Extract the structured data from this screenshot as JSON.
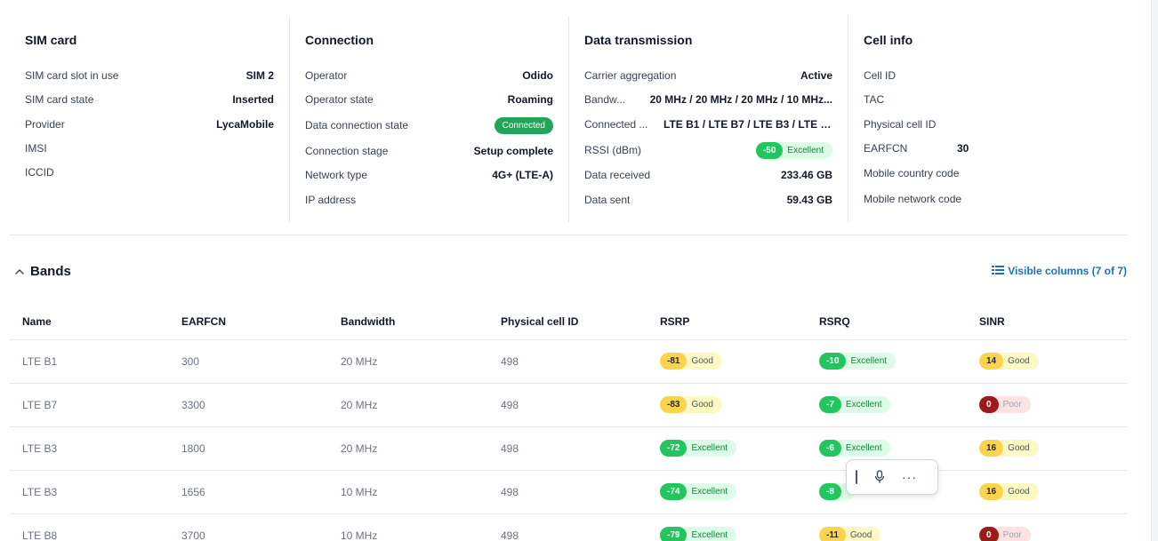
{
  "cards": {
    "sim": {
      "title": "SIM card",
      "rows": [
        {
          "k": "SIM card slot in use",
          "v": "SIM 2"
        },
        {
          "k": "SIM card state",
          "v": "Inserted"
        },
        {
          "k": "Provider",
          "v": "LycaMobile"
        },
        {
          "k": "IMSI",
          "v": ""
        },
        {
          "k": "ICCID",
          "v": ""
        }
      ]
    },
    "connection": {
      "title": "Connection",
      "rows": [
        {
          "k": "Operator",
          "v": "Odido"
        },
        {
          "k": "Operator state",
          "v": "Roaming"
        },
        {
          "k": "Data connection state",
          "v": "Connected"
        },
        {
          "k": "Connection stage",
          "v": "Setup complete"
        },
        {
          "k": "Network type",
          "v": "4G+ (LTE-A)"
        },
        {
          "k": "IP address",
          "v": ""
        }
      ]
    },
    "data": {
      "title": "Data transmission",
      "rows": [
        {
          "k": "Carrier aggregation",
          "v": "Active"
        },
        {
          "k": "Bandw...",
          "v": "20 MHz / 20 MHz / 20 MHz / 10 MHz..."
        },
        {
          "k": "Connected ...",
          "v": "LTE B1 / LTE B7 / LTE B3 / LTE B..."
        },
        {
          "k": "RSSI (dBm)",
          "v": "-50",
          "label": "Excellent"
        },
        {
          "k": "Data received",
          "v": "233.46 GB"
        },
        {
          "k": "Data sent",
          "v": "59.43 GB"
        }
      ]
    },
    "cell": {
      "title": "Cell info",
      "rows": [
        {
          "k": "Cell ID",
          "v": ""
        },
        {
          "k": "TAC",
          "v": ""
        },
        {
          "k": "Physical cell ID",
          "v": ""
        },
        {
          "k": "EARFCN",
          "v": "30"
        },
        {
          "k": "Mobile country code",
          "v": ""
        },
        {
          "k": "Mobile network code",
          "v": ""
        }
      ]
    }
  },
  "bands": {
    "title": "Bands",
    "visible_columns": "Visible columns (7 of 7)",
    "columns": [
      "Name",
      "EARFCN",
      "Bandwidth",
      "Physical cell ID",
      "RSRP",
      "RSRQ",
      "SINR"
    ],
    "rows": [
      {
        "name": "LTE B1",
        "earfcn": "300",
        "bw": "20 MHz",
        "pci": "498",
        "rsrp": {
          "v": "-81",
          "l": "Good",
          "c": "good"
        },
        "rsrq": {
          "v": "-10",
          "l": "Excellent",
          "c": "ex"
        },
        "sinr": {
          "v": "14",
          "l": "Good",
          "c": "good"
        }
      },
      {
        "name": "LTE B7",
        "earfcn": "3300",
        "bw": "20 MHz",
        "pci": "498",
        "rsrp": {
          "v": "-83",
          "l": "Good",
          "c": "good"
        },
        "rsrq": {
          "v": "-7",
          "l": "Excellent",
          "c": "ex"
        },
        "sinr": {
          "v": "0",
          "l": "Poor",
          "c": "poor"
        }
      },
      {
        "name": "LTE B3",
        "earfcn": "1800",
        "bw": "20 MHz",
        "pci": "498",
        "rsrp": {
          "v": "-72",
          "l": "Excellent",
          "c": "ex"
        },
        "rsrq": {
          "v": "-6",
          "l": "Excellent",
          "c": "ex"
        },
        "sinr": {
          "v": "16",
          "l": "Good",
          "c": "good"
        }
      },
      {
        "name": "LTE B3",
        "earfcn": "1656",
        "bw": "10 MHz",
        "pci": "498",
        "rsrp": {
          "v": "-74",
          "l": "Excellent",
          "c": "ex"
        },
        "rsrq": {
          "v": "-8",
          "l": "",
          "c": "ex"
        },
        "sinr": {
          "v": "16",
          "l": "Good",
          "c": "good"
        }
      },
      {
        "name": "LTE B8",
        "earfcn": "3700",
        "bw": "10 MHz",
        "pci": "498",
        "rsrp": {
          "v": "-79",
          "l": "Excellent",
          "c": "ex"
        },
        "rsrq": {
          "v": "-11",
          "l": "Good",
          "c": "good"
        },
        "sinr": {
          "v": "0",
          "l": "Poor",
          "c": "poor"
        }
      }
    ]
  },
  "colors": {
    "accent": "#1d6fbf",
    "excellent": "#22c55e",
    "good": "#fcd34d",
    "poor": "#991b1b"
  }
}
